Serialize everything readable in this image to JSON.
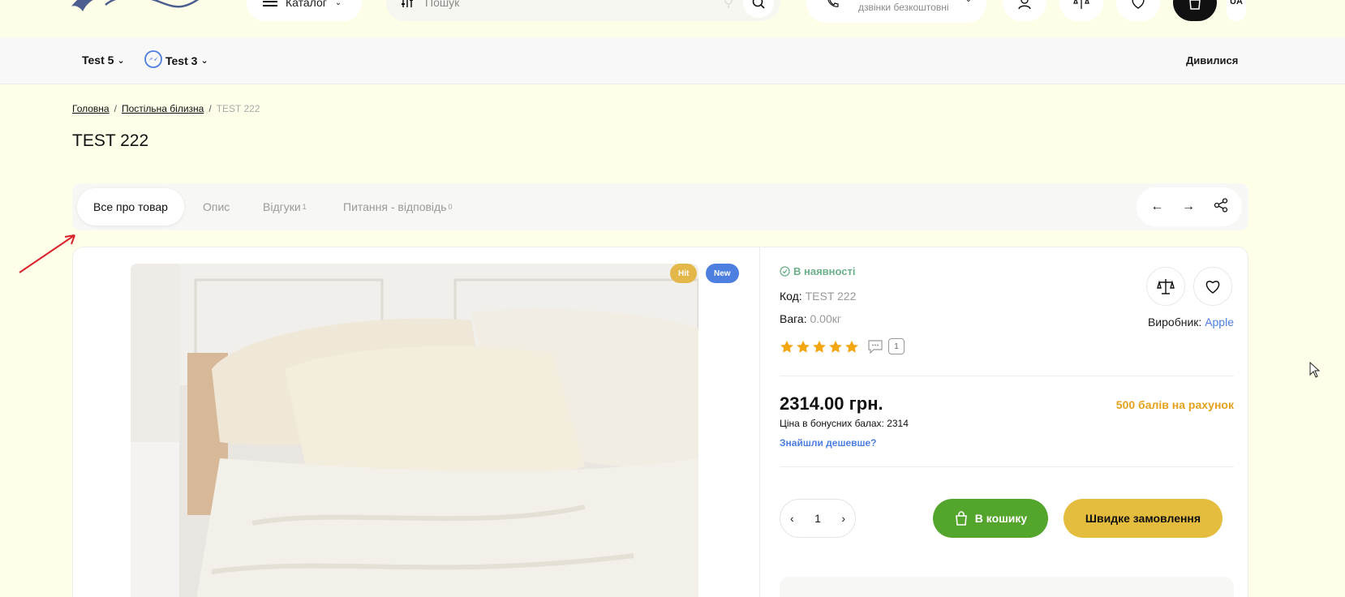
{
  "header": {
    "catalog_label": "Каталог",
    "search_placeholder": "Пошук",
    "phone_subtitle": "дзвінки безкоштовні",
    "lang": "UA"
  },
  "nav": {
    "items": [
      {
        "label": "Test 5"
      },
      {
        "label": "Test 3"
      }
    ],
    "right_link": "Дивилися"
  },
  "breadcrumb": {
    "home": "Головна",
    "category": "Постільна білизна",
    "current": "TEST 222",
    "separator": "/"
  },
  "product": {
    "title": "TEST 222",
    "tabs": [
      {
        "label": "Все про товар",
        "count": ""
      },
      {
        "label": "Опис",
        "count": ""
      },
      {
        "label": "Відгуки",
        "count": "1"
      },
      {
        "label": "Питання - відповідь",
        "count": "0"
      }
    ],
    "badges": {
      "hit": "Hit",
      "new": "New"
    },
    "stock": "В наявності",
    "code_label": "Код:",
    "code_value": "TEST 222",
    "weight_label": "Вага:",
    "weight_value": "0.00кг",
    "manufacturer_label": "Виробник:",
    "manufacturer_value": "Apple",
    "rating": 5,
    "reviews_count": "1",
    "price": "2314.00 грн.",
    "bonus_price": "Ціна в бонусних балах: 2314",
    "found_cheaper": "Знайшли дешевше?",
    "bonus_points": "500 балів на рахунок",
    "quantity": "1",
    "add_to_cart": "В кошику",
    "quick_order": "Швидке замовлення"
  },
  "colors": {
    "page_bg": "#fefee9",
    "green": "#54a52b",
    "yellow": "#e4bd3e",
    "blue": "#4d7fe1",
    "star": "#f3a712"
  }
}
